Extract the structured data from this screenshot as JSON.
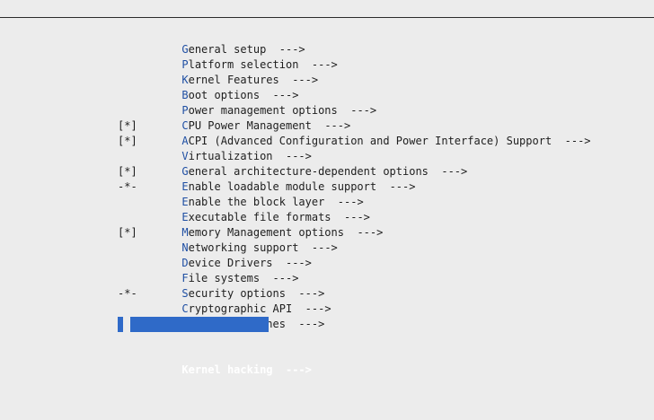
{
  "menu": {
    "items": [
      {
        "mark": "",
        "hotkey": "G",
        "rest": "eneral setup",
        "arrow": "--->"
      },
      {
        "mark": "",
        "hotkey": "P",
        "rest": "latform selection",
        "arrow": "--->"
      },
      {
        "mark": "",
        "hotkey": "K",
        "rest": "ernel Features",
        "arrow": "--->"
      },
      {
        "mark": "",
        "hotkey": "B",
        "rest": "oot options",
        "arrow": "--->"
      },
      {
        "mark": "",
        "hotkey": "P",
        "rest": "ower management options",
        "arrow": "--->"
      },
      {
        "mark": "",
        "hotkey": "C",
        "rest": "PU Power Management",
        "arrow": "--->"
      },
      {
        "mark": "[*]",
        "hotkey": "A",
        "rest": "CPI (Advanced Configuration and Power Interface) Support",
        "arrow": "--->"
      },
      {
        "mark": "[*]",
        "hotkey": "V",
        "rest": "irtualization",
        "arrow": "--->"
      },
      {
        "mark": "",
        "hotkey": "G",
        "rest": "eneral architecture-dependent options",
        "arrow": "--->"
      },
      {
        "mark": "[*]",
        "hotkey": "E",
        "rest": "nable loadable module support",
        "arrow": "--->"
      },
      {
        "mark": "-*-",
        "hotkey": "E",
        "rest": "nable the block layer",
        "arrow": "--->"
      },
      {
        "mark": "",
        "hotkey": "E",
        "rest": "xecutable file formats",
        "arrow": "--->"
      },
      {
        "mark": "",
        "hotkey": "M",
        "rest": "emory Management options",
        "arrow": "--->"
      },
      {
        "mark": "[*]",
        "hotkey": "N",
        "rest": "etworking support",
        "arrow": "--->"
      },
      {
        "mark": "",
        "hotkey": "D",
        "rest": "evice Drivers",
        "arrow": "--->"
      },
      {
        "mark": "",
        "hotkey": "F",
        "rest": "ile systems",
        "arrow": "--->"
      },
      {
        "mark": "",
        "hotkey": "S",
        "rest": "ecurity options",
        "arrow": "--->"
      },
      {
        "mark": "-*-",
        "hotkey": "C",
        "rest": "ryptographic API",
        "arrow": "--->"
      },
      {
        "mark": "",
        "hotkey": "L",
        "rest": "ibrary routines",
        "arrow": "--->"
      },
      {
        "mark": "",
        "hotkey": "K",
        "rest": "ernel hacking",
        "arrow": "--->",
        "selected": true
      }
    ]
  },
  "colors": {
    "background": "#ececec",
    "text": "#1e1e1e",
    "hotkey": "#1f4fa3",
    "selection": "#2f6ac8",
    "selection_text": "#ffffff"
  }
}
